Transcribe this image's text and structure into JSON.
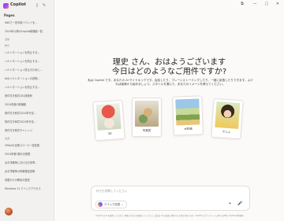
{
  "app": {
    "name": "Copilot"
  },
  "sidebar": {
    "pages_heading": "Pages",
    "items": [
      {
        "label": "SNSで一言市政イベントを...",
        "kind": "item"
      },
      {
        "label": "2024年以降のCopilot新機能一覧",
        "kind": "item"
      },
      {
        "label": "直前",
        "kind": "section"
      },
      {
        "label": "昨日",
        "kind": "section"
      },
      {
        "label": "ハルシネーションを防止する...",
        "kind": "item"
      },
      {
        "label": "ハルシネーションを防止する...",
        "kind": "item"
      },
      {
        "label": "ハルシネーション防止のために...",
        "kind": "item"
      },
      {
        "label": "AIのハルシネーションの説明...",
        "kind": "item"
      },
      {
        "label": "ハルシネーションを防止する...",
        "kind": "item"
      },
      {
        "label": "条件付き和式CEL検索例",
        "kind": "item"
      },
      {
        "label": "2024年度の新機能",
        "kind": "item"
      },
      {
        "label": "条件付き和式2024年予定...",
        "kind": "item"
      },
      {
        "label": "条件付き和式2024年予定...",
        "kind": "item"
      },
      {
        "label": "条件付き和式チャレンジ",
        "kind": "item"
      },
      {
        "label": "先週",
        "kind": "section"
      },
      {
        "label": "Officeの全角スペース一括変換",
        "kind": "item"
      },
      {
        "label": "2024年第1期の日程表",
        "kind": "item"
      },
      {
        "label": "太平洋戦争における日本軍...",
        "kind": "item"
      },
      {
        "label": "太平洋戦争の終戦理由説明",
        "kind": "item"
      },
      {
        "label": "米国からの移民の歴史",
        "kind": "item"
      },
      {
        "label": "Windows 11 クイックアクセス",
        "kind": "item"
      }
    ]
  },
  "main": {
    "greeting_line1": "理史 さん、おはようございます",
    "greeting_line2": "今日はどのようなご用件ですか?",
    "description": "私は Copilot です。あなたの AI サイドキックです。会話したり、ブレーンストーミングしたり、一緒に創造したりできます。よければ画像から始めましょう。スタイルを選んで、あなたのイメージを教えてください。",
    "cards": [
      {
        "label": "3D"
      },
      {
        "label": "写実的"
      },
      {
        "label": "水彩画"
      },
      {
        "label": "アニメ"
      }
    ]
  },
  "input": {
    "placeholder": "何でも質問してください",
    "mode_label": "クイック応答",
    "mode_chevron": "⌄"
  },
  "disclaimer": "Copilot は AI を使用しています。間違いがないか確認してください。会話は AI の改善に利用される場合があります。Copilot のプライバシーに関する声明 | Copilot 利用規約",
  "colors": {
    "accent": "#2b7bff",
    "sidebar_bg": "#f3f1ef",
    "main_bg": "#fbfaf9"
  }
}
